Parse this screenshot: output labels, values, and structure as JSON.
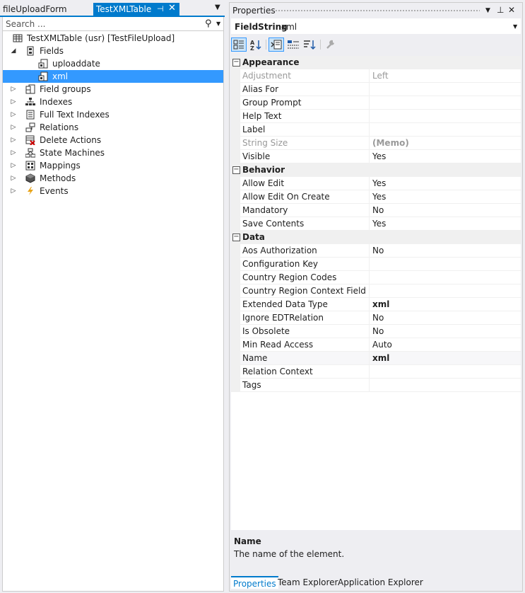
{
  "left_tabs": {
    "inactive_tab": "fileUploadForm",
    "active_tab": "TestXMLTable",
    "pin_icon": "pin-icon",
    "close_icon": "close-icon"
  },
  "search": {
    "placeholder": "Search ..."
  },
  "tree": {
    "root": "TestXMLTable (usr) [TestFileUpload]",
    "fields": "Fields",
    "field_items": [
      "uploaddate",
      "xml"
    ],
    "nodes": [
      "Field groups",
      "Indexes",
      "Full Text Indexes",
      "Relations",
      "Delete Actions",
      "State Machines",
      "Mappings",
      "Methods",
      "Events"
    ]
  },
  "properties": {
    "title": "Properties",
    "object_type": "FieldString",
    "object_name": "xml",
    "categories": [
      {
        "name": "Appearance",
        "rows": [
          {
            "name": "Adjustment",
            "value": "Left",
            "disabled": true
          },
          {
            "name": "Alias For",
            "value": ""
          },
          {
            "name": "Group Prompt",
            "value": ""
          },
          {
            "name": "Help Text",
            "value": ""
          },
          {
            "name": "Label",
            "value": ""
          },
          {
            "name": "String Size",
            "value": "(Memo)",
            "disabled": true,
            "bold": true
          },
          {
            "name": "Visible",
            "value": "Yes"
          }
        ]
      },
      {
        "name": "Behavior",
        "rows": [
          {
            "name": "Allow Edit",
            "value": "Yes"
          },
          {
            "name": "Allow Edit On Create",
            "value": "Yes"
          },
          {
            "name": "Mandatory",
            "value": "No"
          },
          {
            "name": "Save Contents",
            "value": "Yes"
          }
        ]
      },
      {
        "name": "Data",
        "rows": [
          {
            "name": "Aos Authorization",
            "value": "No"
          },
          {
            "name": "Configuration Key",
            "value": ""
          },
          {
            "name": "Country Region Codes",
            "value": ""
          },
          {
            "name": "Country Region Context Field",
            "value": ""
          },
          {
            "name": "Extended Data Type",
            "value": "xml",
            "bold": true
          },
          {
            "name": "Ignore EDTRelation",
            "value": "No"
          },
          {
            "name": "Is Obsolete",
            "value": "No"
          },
          {
            "name": "Min Read Access",
            "value": "Auto"
          },
          {
            "name": "Name",
            "value": "xml",
            "bold": true
          },
          {
            "name": "Relation Context",
            "value": ""
          },
          {
            "name": "Tags",
            "value": ""
          }
        ]
      }
    ],
    "description_title": "Name",
    "description_text": "The name of the element."
  },
  "bottom_tabs": [
    "Properties",
    "Team Explorer",
    "Application Explorer"
  ],
  "colors": {
    "accent": "#007acc",
    "selection": "#3399ff",
    "event_icon": "#e8a317"
  }
}
